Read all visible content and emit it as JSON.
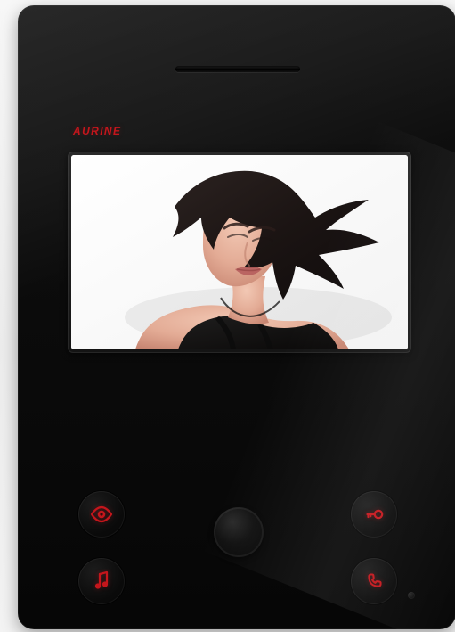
{
  "device": {
    "brand_label": "AURINE"
  },
  "colors": {
    "indicator_red": "#c4161c"
  }
}
